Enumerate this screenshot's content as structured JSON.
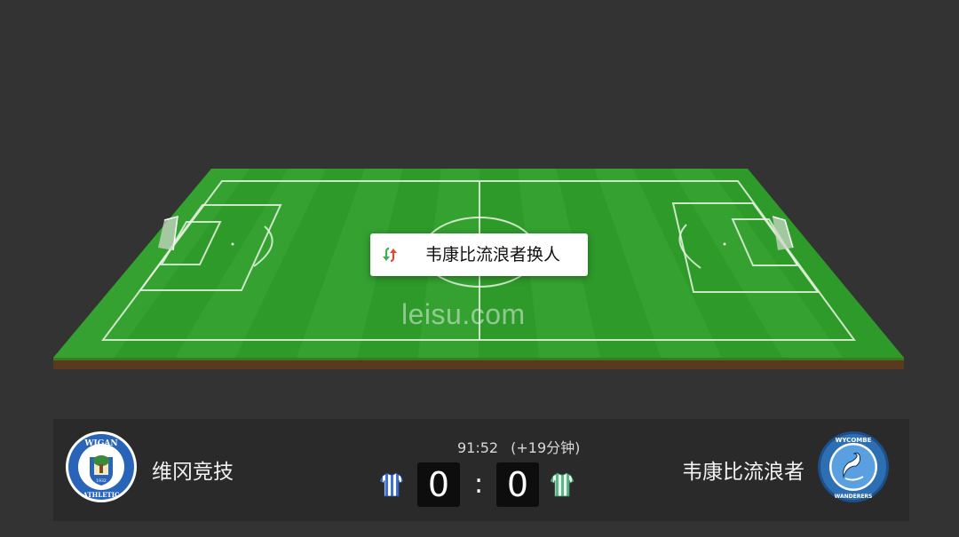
{
  "event": {
    "text": "韦康比流浪者换人",
    "icon": "substitution-icon",
    "colors": {
      "in": "#3cb04a",
      "out": "#e0483b"
    }
  },
  "watermark": "leisu.com",
  "match": {
    "time": "91:52",
    "added_time": "(+19分钟)",
    "home": {
      "name": "维冈竞技",
      "score": "0",
      "crest": "wigan-athletic-crest",
      "crest_text": "WIGAN ATHLETIC 1932",
      "kit_colors": [
        "#3f6fcf",
        "#ffffff"
      ]
    },
    "away": {
      "name": "韦康比流浪者",
      "score": "0",
      "crest": "wycombe-wanderers-crest",
      "crest_text": "WYCOMBE WANDERERS",
      "kit_colors": [
        "#5fb58a",
        "#ffffff"
      ]
    },
    "separator": ":"
  },
  "colors": {
    "background": "#333333",
    "pitch": "#2f9a2a",
    "scoreboard": "#2a2a2a"
  }
}
